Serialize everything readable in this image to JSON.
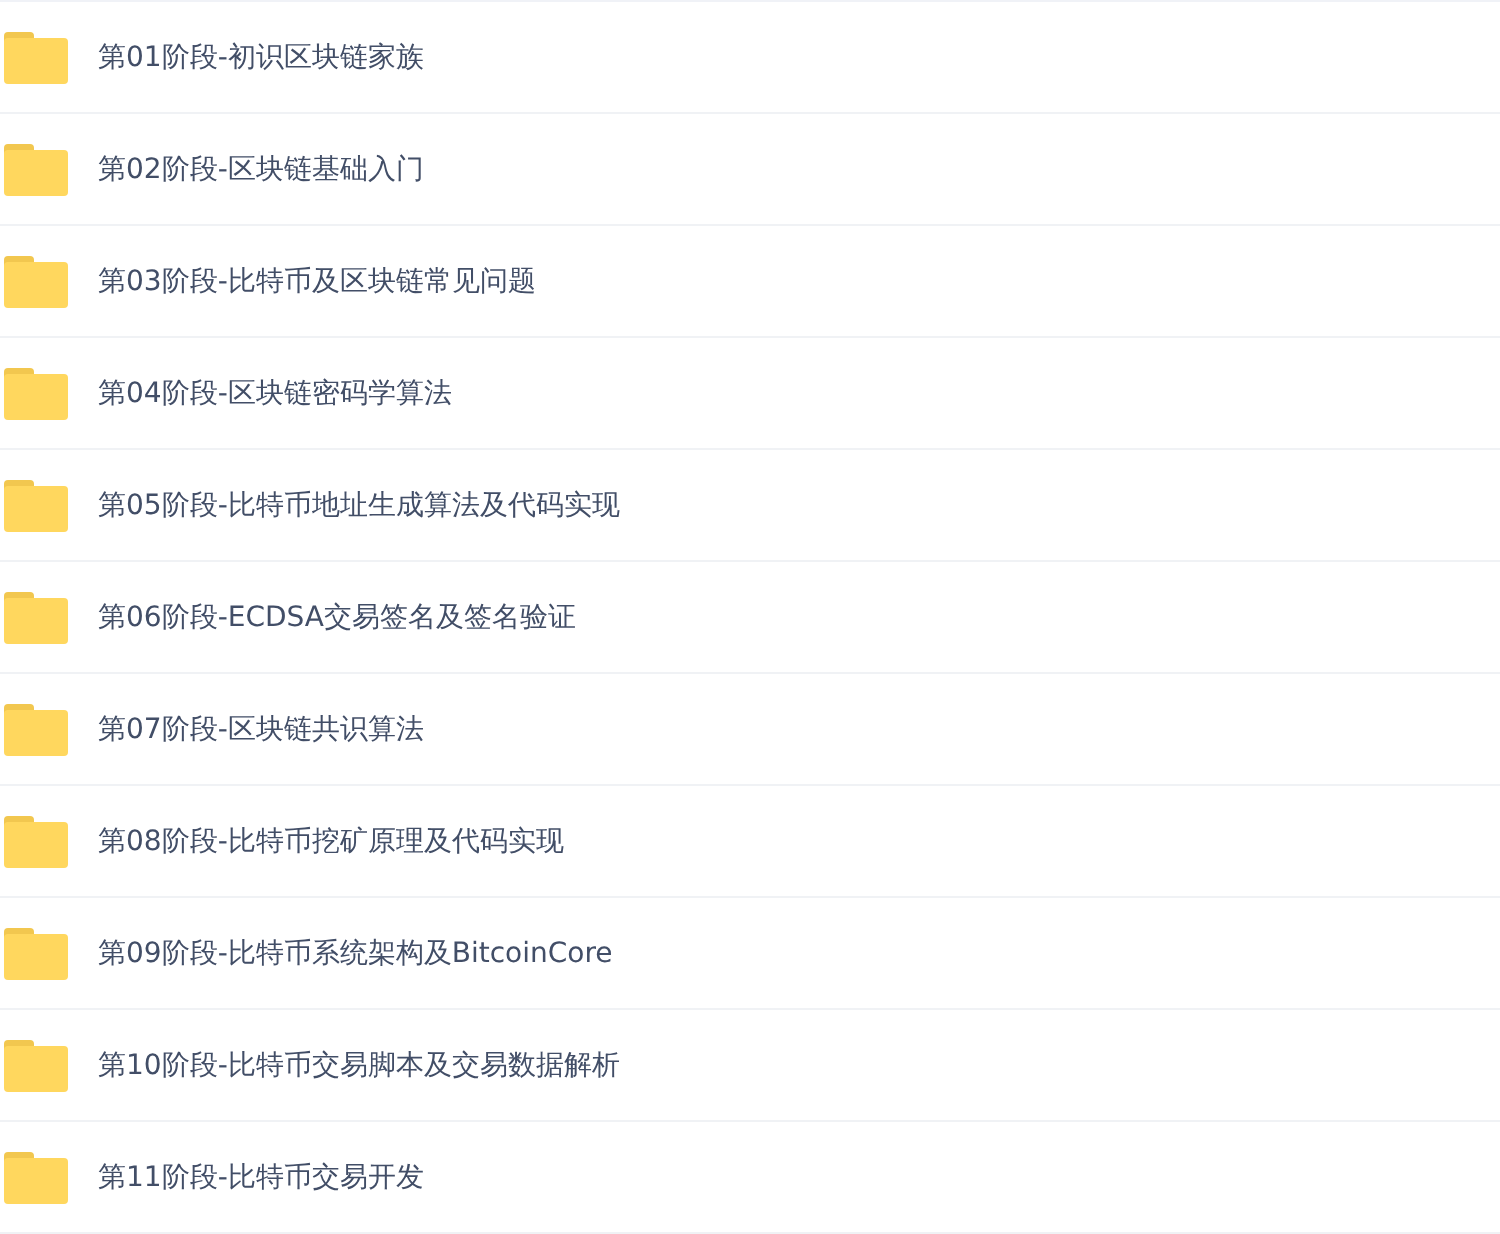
{
  "folders": [
    {
      "name": "第01阶段-初识区块链家族"
    },
    {
      "name": "第02阶段-区块链基础入门"
    },
    {
      "name": "第03阶段-比特币及区块链常见问题"
    },
    {
      "name": "第04阶段-区块链密码学算法"
    },
    {
      "name": "第05阶段-比特币地址生成算法及代码实现"
    },
    {
      "name": "第06阶段-ECDSA交易签名及签名验证"
    },
    {
      "name": "第07阶段-区块链共识算法"
    },
    {
      "name": "第08阶段-比特币挖矿原理及代码实现"
    },
    {
      "name": "第09阶段-比特币系统架构及BitcoinCore"
    },
    {
      "name": "第10阶段-比特币交易脚本及交易数据解析"
    },
    {
      "name": "第11阶段-比特币交易开发"
    }
  ]
}
